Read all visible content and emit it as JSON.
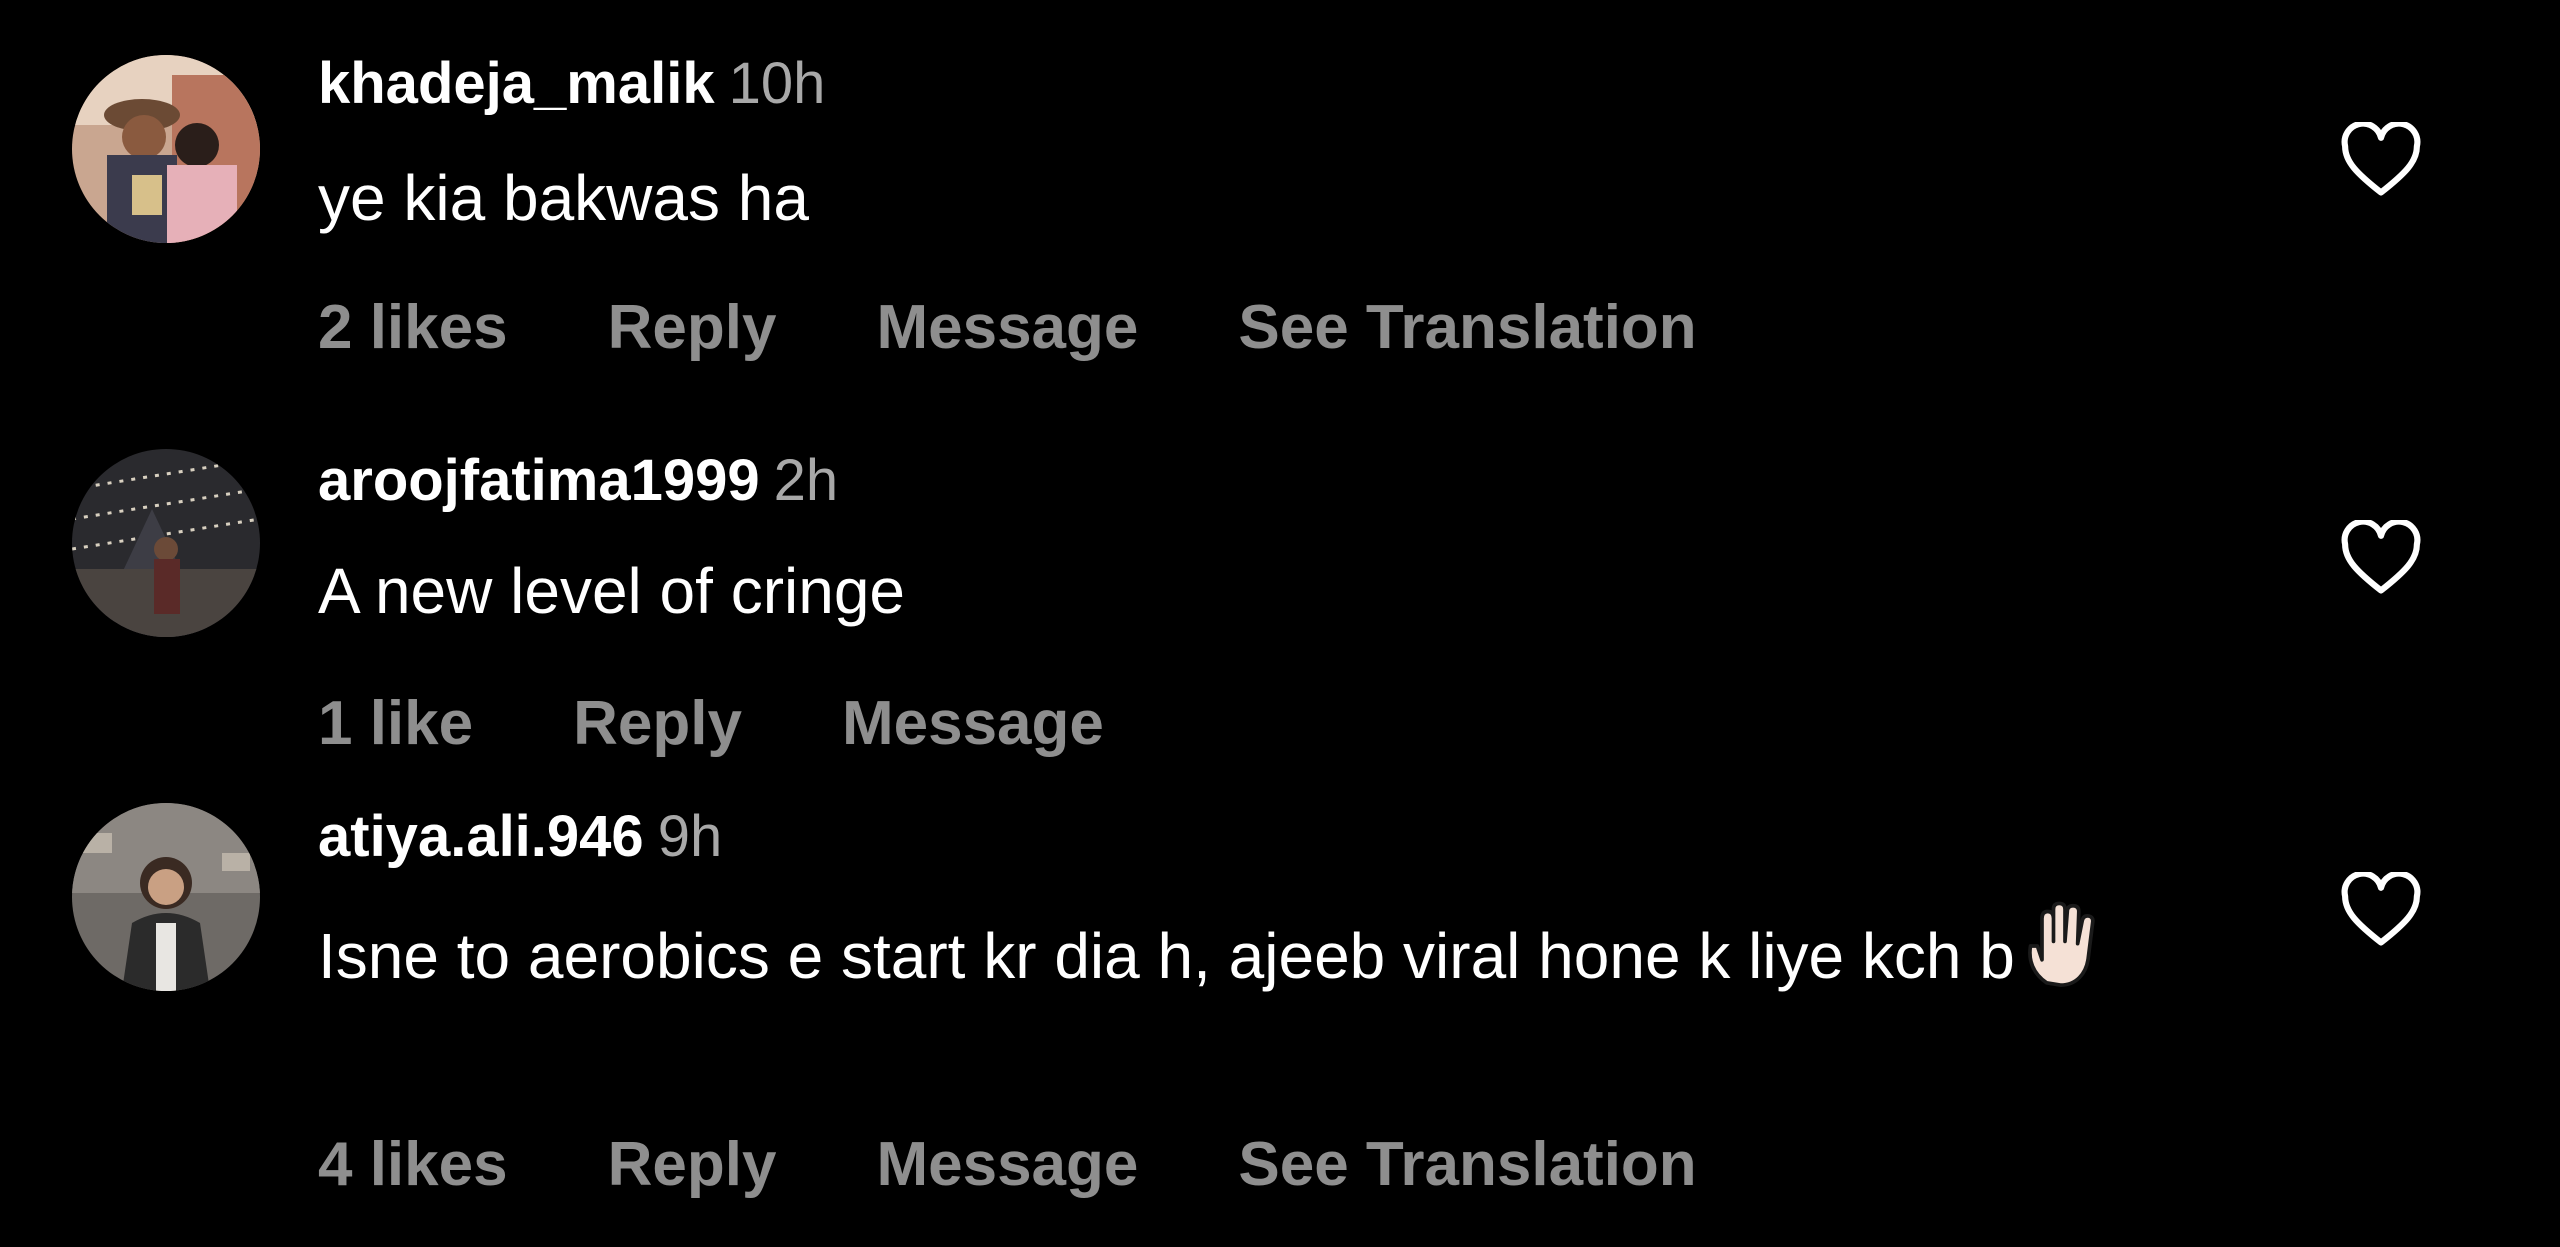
{
  "comments": [
    {
      "username": "khadeja_malik",
      "time": "10h",
      "text": "ye kia bakwas ha",
      "likes": "2 likes",
      "reply": "Reply",
      "message": "Message",
      "translate": "See Translation",
      "avatar_icon": "user-photo-couple-avatar"
    },
    {
      "username": "aroojfatima1999",
      "time": "2h",
      "text": "A new level of cringe",
      "likes": "1 like",
      "reply": "Reply",
      "message": "Message",
      "avatar_icon": "user-photo-lights-avatar"
    },
    {
      "username": "atiya.ali.946",
      "time": "9h",
      "text": "Isne to aerobics e start kr dia h, ajeeb viral hone k liye kch b",
      "emoji": "raised-hand-emoji",
      "likes": "4 likes",
      "reply": "Reply",
      "message": "Message",
      "translate": "See Translation",
      "avatar_icon": "user-photo-portrait-avatar"
    }
  ],
  "colors": {
    "background": "#000000",
    "text_primary": "#ffffff",
    "text_secondary": "#a8a8a8",
    "action_text": "#8e8e8e"
  },
  "icons": {
    "like": "heart-outline-icon"
  }
}
